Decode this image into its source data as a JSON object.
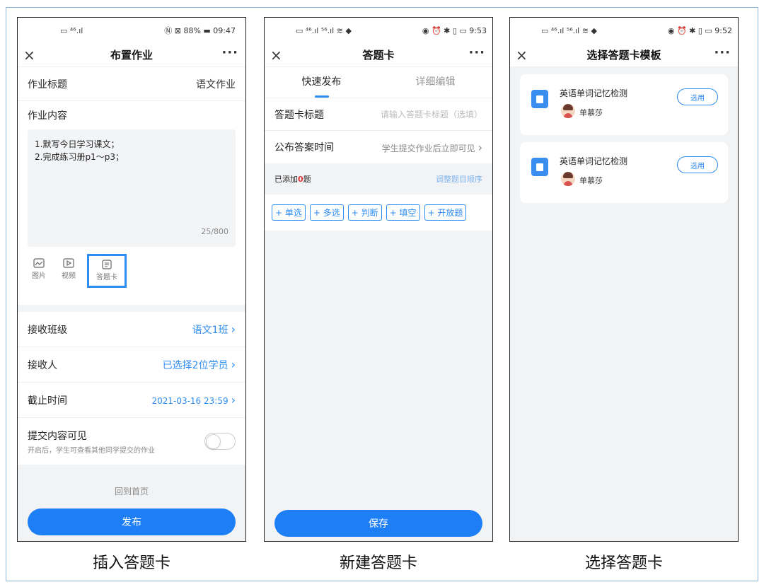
{
  "captions": [
    "插入答题卡",
    "新建答题卡",
    "选择答题卡"
  ],
  "screen1": {
    "status_left": "▭ ⁴⁶.ıl",
    "status_right": "Ⓝ ⊠ 88% ▬ 09:47",
    "title": "布置作业",
    "close": "×",
    "more": "···",
    "hw_title_label": "作业标题",
    "hw_title_value": "语文作业",
    "hw_content_label": "作业内容",
    "content_lines": [
      "1.默写今日学习课文；",
      "2.完成练习册p1～p3；"
    ],
    "char_count": "25/800",
    "attachments": [
      {
        "label": "图片",
        "icon": "image-icon"
      },
      {
        "label": "视频",
        "icon": "video-icon"
      },
      {
        "label": "答题卡",
        "icon": "answer-card-icon"
      }
    ],
    "class_label": "接收班级",
    "class_value": "语文1班",
    "receiver_label": "接收人",
    "receiver_value": "已选择2位学员",
    "deadline_label": "截止时间",
    "deadline_value": "2021-03-16 23:59",
    "visible_label": "提交内容可见",
    "visible_desc": "开启后，学生可查看其他同学提交的作业",
    "visible_on": false,
    "home_link": "回到首页",
    "publish": "发布",
    "arrow": "›"
  },
  "screen2": {
    "status_left": "▭ ⁴⁶.ıl ⁵⁶.ıl ≋ ◆",
    "status_right": "◉ ⏰ ✱ ▯ ▭ 9:53",
    "title": "答题卡",
    "close": "×",
    "more": "···",
    "tabs": [
      "快速发布",
      "详细编辑"
    ],
    "card_title_label": "答题卡标题",
    "card_title_placeholder": "请输入答题卡标题（选填）",
    "answer_time_label": "公布答案时间",
    "answer_time_value": "学生提交作业后立即可见",
    "added_prefix": "已添加",
    "added_count": "0",
    "added_suffix": "题",
    "reorder": "调整题目顺序",
    "chips": [
      "+ 单选",
      "+ 多选",
      "+ 判断",
      "+ 填空",
      "+ 开放题"
    ],
    "save": "保存",
    "arrow": "›"
  },
  "screen3": {
    "status_left": "▭ ⁴⁶.ıl ⁵⁶.ıl ≋ ◆",
    "status_right": "◉ ⏰ ✱ ▯ ▭ 9:52",
    "title": "选择答题卡模板",
    "close": "×",
    "more": "···",
    "templates": [
      {
        "name": "英语单词记忆检测",
        "author": "单慕莎",
        "action": "选用"
      },
      {
        "name": "英语单词记忆检测",
        "author": "单慕莎",
        "action": "选用"
      }
    ]
  },
  "colors": {
    "accent": "#2d8cf0",
    "button": "#1d7ef5",
    "frame": "#8fb4de"
  }
}
